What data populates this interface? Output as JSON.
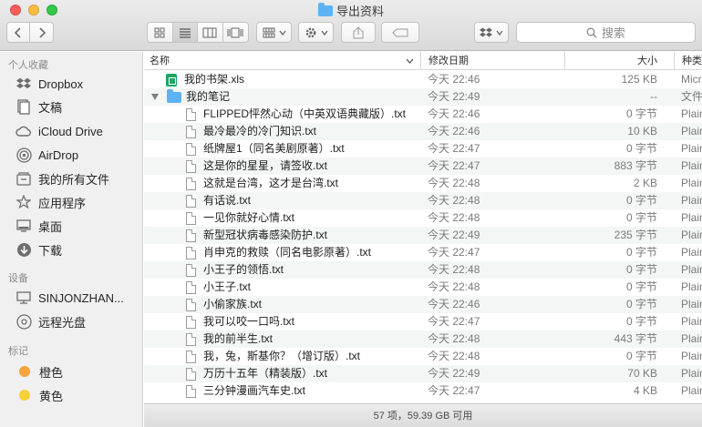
{
  "window": {
    "title": "导出资料"
  },
  "toolbar": {
    "back_icon": "chevron-left-icon",
    "forward_icon": "chevron-right-icon",
    "view_icons": [
      "grid-view-icon",
      "list-view-icon",
      "column-view-icon",
      "cover-flow-icon"
    ],
    "active_view": "list",
    "search_placeholder": "搜索"
  },
  "sidebar": {
    "favorites_header": "个人收藏",
    "favorites": [
      {
        "label": "Dropbox",
        "icon": "dropbox-icon"
      },
      {
        "label": "文稿",
        "icon": "documents-icon"
      },
      {
        "label": "iCloud Drive",
        "icon": "cloud-icon"
      },
      {
        "label": "AirDrop",
        "icon": "airdrop-icon"
      },
      {
        "label": "我的所有文件",
        "icon": "all-files-icon"
      },
      {
        "label": "应用程序",
        "icon": "applications-icon"
      },
      {
        "label": "桌面",
        "icon": "desktop-icon"
      },
      {
        "label": "下载",
        "icon": "download-icon"
      }
    ],
    "devices_header": "设备",
    "devices": [
      {
        "label": "SINJONZHAN...",
        "icon": "computer-icon"
      },
      {
        "label": "远程光盘",
        "icon": "disc-icon"
      }
    ],
    "tags_header": "标记",
    "tags": [
      {
        "label": "橙色",
        "color": "#f6a33a"
      },
      {
        "label": "黄色",
        "color": "#f7cf3c"
      }
    ]
  },
  "columns": {
    "name": "名称",
    "date": "修改日期",
    "size": "大小",
    "kind": "种类"
  },
  "files": [
    {
      "name": "我的书架.xls",
      "date": "今天 22:46",
      "size": "125 KB",
      "kind": "Micr",
      "type": "xls",
      "indent": 0
    },
    {
      "name": "我的笔记",
      "date": "今天 22:49",
      "size": "--",
      "kind": "文件",
      "type": "folder",
      "indent": 0
    },
    {
      "name": "FLIPPED怦然心动（中英双语典藏版）.txt",
      "date": "今天 22:46",
      "size": "0 字节",
      "kind": "Plain",
      "type": "txt",
      "indent": 1
    },
    {
      "name": "最冷最冷的冷门知识.txt",
      "date": "今天 22:46",
      "size": "10 KB",
      "kind": "Plain",
      "type": "txt",
      "indent": 1
    },
    {
      "name": "纸牌屋1（同名美剧原著）.txt",
      "date": "今天 22:47",
      "size": "0 字节",
      "kind": "Plain",
      "type": "txt",
      "indent": 1
    },
    {
      "name": "这是你的星星，请签收.txt",
      "date": "今天 22:47",
      "size": "883 字节",
      "kind": "Plain",
      "type": "txt",
      "indent": 1
    },
    {
      "name": "这就是台湾，这才是台湾.txt",
      "date": "今天 22:48",
      "size": "2 KB",
      "kind": "Plain",
      "type": "txt",
      "indent": 1
    },
    {
      "name": "有话说.txt",
      "date": "今天 22:48",
      "size": "0 字节",
      "kind": "Plain",
      "type": "txt",
      "indent": 1
    },
    {
      "name": "一见你就好心情.txt",
      "date": "今天 22:48",
      "size": "0 字节",
      "kind": "Plain",
      "type": "txt",
      "indent": 1
    },
    {
      "name": "新型冠状病毒感染防护.txt",
      "date": "今天 22:49",
      "size": "235 字节",
      "kind": "Plain",
      "type": "txt",
      "indent": 1
    },
    {
      "name": "肖申克的救赎（同名电影原著）.txt",
      "date": "今天 22:47",
      "size": "0 字节",
      "kind": "Plain",
      "type": "txt",
      "indent": 1
    },
    {
      "name": "小王子的领悟.txt",
      "date": "今天 22:48",
      "size": "0 字节",
      "kind": "Plain",
      "type": "txt",
      "indent": 1
    },
    {
      "name": "小王子.txt",
      "date": "今天 22:48",
      "size": "0 字节",
      "kind": "Plain",
      "type": "txt",
      "indent": 1
    },
    {
      "name": "小偷家族.txt",
      "date": "今天 22:46",
      "size": "0 字节",
      "kind": "Plain",
      "type": "txt",
      "indent": 1
    },
    {
      "name": "我可以咬一口吗.txt",
      "date": "今天 22:47",
      "size": "0 字节",
      "kind": "Plain",
      "type": "txt",
      "indent": 1
    },
    {
      "name": "我的前半生.txt",
      "date": "今天 22:48",
      "size": "443 字节",
      "kind": "Plain",
      "type": "txt",
      "indent": 1
    },
    {
      "name": "我，兔，斯基你？（增订版）.txt",
      "date": "今天 22:48",
      "size": "0 字节",
      "kind": "Plain",
      "type": "txt",
      "indent": 1
    },
    {
      "name": "万历十五年（精装版）.txt",
      "date": "今天 22:49",
      "size": "70 KB",
      "kind": "Plain",
      "type": "txt",
      "indent": 1
    },
    {
      "name": "三分钟漫画汽车史.txt",
      "date": "今天 22:47",
      "size": "4 KB",
      "kind": "Plain",
      "type": "txt",
      "indent": 1
    }
  ],
  "status": {
    "text": "57 项，59.39 GB 可用"
  }
}
